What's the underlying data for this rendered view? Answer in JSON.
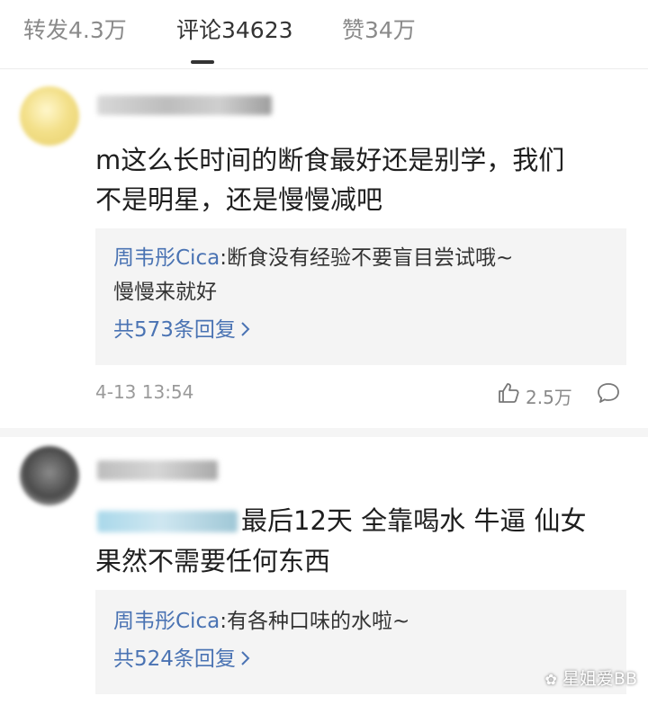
{
  "tabs": [
    {
      "label": "转发4.3万"
    },
    {
      "label": "评论34623"
    },
    {
      "label": "赞34万"
    }
  ],
  "comments": [
    {
      "text_lines": [
        "m这么长时间的断食最好还是别学，我们",
        "不是明星，还是慢慢减吧"
      ],
      "reply": {
        "author": "周韦彤Cica",
        "line1": ":断食没有经验不要盲目尝试哦~",
        "line2": "慢慢来就好",
        "more": "共573条回复"
      },
      "time": "4-13 13:54",
      "likes": "2.5万"
    },
    {
      "text_lines": [
        "最后12天 全靠喝水 牛逼 仙女",
        "果然不需要任何东西"
      ],
      "reply": {
        "author": "周韦彤Cica",
        "line1": ":有各种口味的水啦~",
        "more": "共524条回复"
      }
    }
  ],
  "watermark": "星姐爱BB",
  "icons": {
    "like": "thumbs-up-icon",
    "comment": "comment-bubble-icon",
    "chevron": "chevron-right-icon"
  },
  "colors": {
    "link": "#4a73b3",
    "reply_bg": "#f4f4f4",
    "muted": "#8a8a8a"
  }
}
